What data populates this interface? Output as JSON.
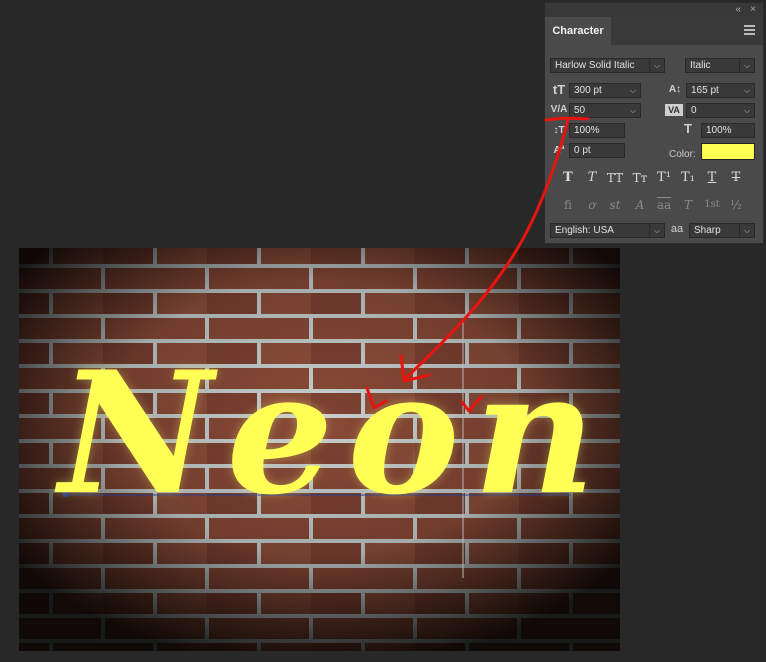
{
  "panel": {
    "title": "Character",
    "collapse_icon": "double-chevron-icon",
    "close_icon": "close-icon",
    "font_family": "Harlow Solid Italic",
    "font_style": "Italic",
    "font_size": "300 pt",
    "leading": "165 pt",
    "kerning": "50",
    "tracking": "0",
    "vertical_scale": "100%",
    "horizontal_scale": "100%",
    "baseline_shift": "0 pt",
    "color_label": "Color:",
    "color_value": "#ffff55",
    "style_buttons": [
      "T",
      "T",
      "TT",
      "Tт",
      "T¹",
      "T₁",
      "T",
      "T"
    ],
    "opentype_buttons": [
      "fi",
      "ơ",
      "st",
      "A",
      "aa",
      "T",
      "1st",
      "½"
    ],
    "language": "English: USA",
    "aa_icon": "aa",
    "antialias": "Sharp"
  },
  "canvas": {
    "text": "Neon",
    "text_color": "#ffff55"
  },
  "annotation": {
    "color": "#e8140f"
  }
}
